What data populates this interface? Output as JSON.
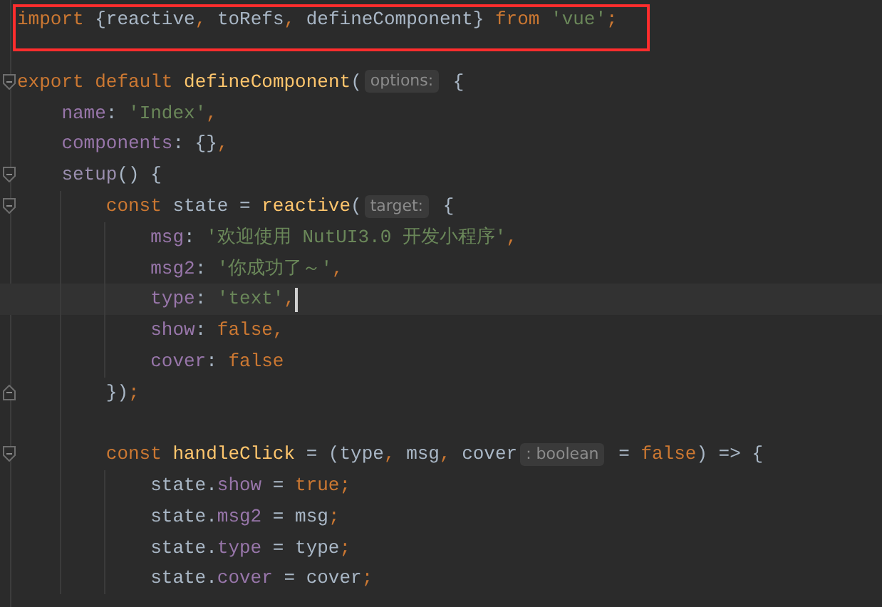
{
  "editor": {
    "lines": [
      {
        "kind": "code",
        "annotated": true,
        "tokens": [
          {
            "kind": "keyword",
            "text": "import"
          },
          {
            "kind": "plain",
            "text": " {reactive"
          },
          {
            "kind": "keyword",
            "text": ","
          },
          {
            "kind": "plain",
            "text": " toRefs"
          },
          {
            "kind": "keyword",
            "text": ","
          },
          {
            "kind": "plain",
            "text": " defineComponent} "
          },
          {
            "kind": "keyword",
            "text": "from "
          },
          {
            "kind": "string",
            "text": "'vue'"
          },
          {
            "kind": "keyword",
            "text": ";"
          }
        ]
      },
      {
        "kind": "blank"
      },
      {
        "kind": "code",
        "fold_start": true,
        "tokens": [
          {
            "kind": "keyword",
            "text": "export default "
          },
          {
            "kind": "function",
            "text": "defineComponent"
          },
          {
            "kind": "plain",
            "text": "("
          },
          {
            "kind": "hint",
            "text": "options:"
          },
          {
            "kind": "plain",
            "text": " {"
          }
        ],
        "children": [
          {
            "kind": "code",
            "tokens": [
              {
                "kind": "property",
                "text": "name"
              },
              {
                "kind": "plain",
                "text": ": "
              },
              {
                "kind": "string",
                "text": "'Index'"
              },
              {
                "kind": "keyword",
                "text": ","
              }
            ]
          },
          {
            "kind": "code",
            "tokens": [
              {
                "kind": "property",
                "text": "components"
              },
              {
                "kind": "plain",
                "text": ": {}"
              },
              {
                "kind": "keyword",
                "text": ","
              }
            ]
          },
          {
            "kind": "code",
            "fold_start": true,
            "tokens": [
              {
                "kind": "method",
                "text": "setup"
              },
              {
                "kind": "plain",
                "text": "() {"
              }
            ],
            "children": [
              {
                "kind": "code",
                "fold_start": true,
                "tokens": [
                  {
                    "kind": "keyword",
                    "text": "const "
                  },
                  {
                    "kind": "plain",
                    "text": "state = "
                  },
                  {
                    "kind": "function",
                    "text": "reactive"
                  },
                  {
                    "kind": "plain",
                    "text": "("
                  },
                  {
                    "kind": "hint",
                    "text": "target:"
                  },
                  {
                    "kind": "plain",
                    "text": " {"
                  }
                ],
                "children": [
                  {
                    "kind": "code",
                    "tokens": [
                      {
                        "kind": "property",
                        "text": "msg"
                      },
                      {
                        "kind": "plain",
                        "text": ": "
                      },
                      {
                        "kind": "string",
                        "text": "'欢迎使用 NutUI3.0 开发小程序'"
                      },
                      {
                        "kind": "keyword",
                        "text": ","
                      }
                    ]
                  },
                  {
                    "kind": "code",
                    "tokens": [
                      {
                        "kind": "property",
                        "text": "msg2"
                      },
                      {
                        "kind": "plain",
                        "text": ": "
                      },
                      {
                        "kind": "string",
                        "text": "'你成功了～'"
                      },
                      {
                        "kind": "keyword",
                        "text": ","
                      }
                    ]
                  },
                  {
                    "kind": "code",
                    "current": true,
                    "tokens": [
                      {
                        "kind": "property",
                        "text": "type"
                      },
                      {
                        "kind": "plain",
                        "text": ": "
                      },
                      {
                        "kind": "string",
                        "text": "'text'"
                      },
                      {
                        "kind": "keyword",
                        "text": ","
                      }
                    ]
                  },
                  {
                    "kind": "code",
                    "tokens": [
                      {
                        "kind": "property",
                        "text": "show"
                      },
                      {
                        "kind": "plain",
                        "text": ": "
                      },
                      {
                        "kind": "keyword",
                        "text": "false,"
                      }
                    ]
                  },
                  {
                    "kind": "code",
                    "tokens": [
                      {
                        "kind": "property",
                        "text": "cover"
                      },
                      {
                        "kind": "plain",
                        "text": ": "
                      },
                      {
                        "kind": "keyword",
                        "text": "false"
                      }
                    ]
                  }
                ]
              },
              {
                "kind": "code",
                "fold_end": true,
                "tokens": [
                  {
                    "kind": "plain",
                    "text": "})"
                  },
                  {
                    "kind": "keyword",
                    "text": ";"
                  }
                ]
              },
              {
                "kind": "blank"
              },
              {
                "kind": "code",
                "fold_start": true,
                "tokens": [
                  {
                    "kind": "keyword",
                    "text": "const "
                  },
                  {
                    "kind": "function",
                    "text": "handleClick"
                  },
                  {
                    "kind": "plain",
                    "text": " = (type"
                  },
                  {
                    "kind": "keyword",
                    "text": ", "
                  },
                  {
                    "kind": "plain",
                    "text": "msg"
                  },
                  {
                    "kind": "keyword",
                    "text": ", "
                  },
                  {
                    "kind": "plain",
                    "text": "cover"
                  },
                  {
                    "kind": "hint",
                    "text": ": boolean"
                  },
                  {
                    "kind": "plain",
                    "text": " = "
                  },
                  {
                    "kind": "keyword",
                    "text": "false"
                  },
                  {
                    "kind": "plain",
                    "text": ") => {"
                  }
                ],
                "children": [
                  {
                    "kind": "code",
                    "tokens": [
                      {
                        "kind": "plain",
                        "text": "state."
                      },
                      {
                        "kind": "property",
                        "text": "show"
                      },
                      {
                        "kind": "plain",
                        "text": " = "
                      },
                      {
                        "kind": "keyword",
                        "text": "true;"
                      }
                    ]
                  },
                  {
                    "kind": "code",
                    "tokens": [
                      {
                        "kind": "plain",
                        "text": "state."
                      },
                      {
                        "kind": "property",
                        "text": "msg2"
                      },
                      {
                        "kind": "plain",
                        "text": " = msg"
                      },
                      {
                        "kind": "keyword",
                        "text": ";"
                      }
                    ]
                  },
                  {
                    "kind": "code",
                    "tokens": [
                      {
                        "kind": "plain",
                        "text": "state."
                      },
                      {
                        "kind": "property",
                        "text": "type"
                      },
                      {
                        "kind": "plain",
                        "text": " = type"
                      },
                      {
                        "kind": "keyword",
                        "text": ";"
                      }
                    ]
                  },
                  {
                    "kind": "code",
                    "tokens": [
                      {
                        "kind": "plain",
                        "text": "state."
                      },
                      {
                        "kind": "property",
                        "text": "cover"
                      },
                      {
                        "kind": "plain",
                        "text": " = cover"
                      },
                      {
                        "kind": "keyword",
                        "text": ";"
                      }
                    ]
                  }
                ]
              }
            ]
          }
        ]
      }
    ]
  }
}
